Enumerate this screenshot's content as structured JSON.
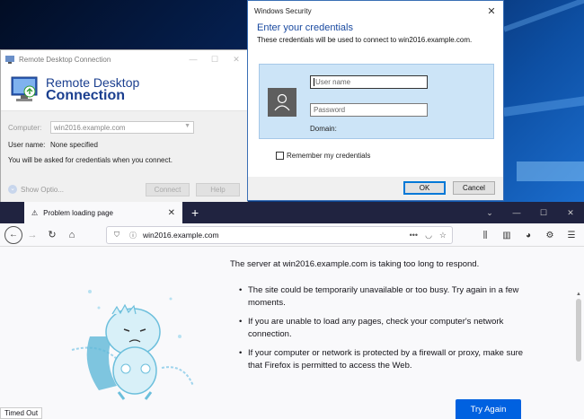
{
  "rdc": {
    "title": "Remote Desktop Connection",
    "heading_line1": "Remote Desktop",
    "heading_line2": "Connection",
    "computer_label": "Computer:",
    "computer_value": "win2016.example.com",
    "username_label": "User name:",
    "username_value": "None specified",
    "note": "You will be asked for credentials when you connect.",
    "show_options": "Show Optio...",
    "connect_label": "Connect",
    "help_label": "Help"
  },
  "security": {
    "title": "Windows Security",
    "heading": "Enter your credentials",
    "subtitle": "These credentials will be used to connect to win2016.example.com.",
    "username_placeholder": "User name",
    "password_placeholder": "Password",
    "domain_label": "Domain:",
    "remember_label": "Remember my credentials",
    "ok_label": "OK",
    "cancel_label": "Cancel"
  },
  "firefox": {
    "tab_title": "Problem loading page",
    "url": "win2016.example.com",
    "error_title": "The server at win2016.example.com is taking too long to respond.",
    "bullets": [
      "The site could be temporarily unavailable or too busy. Try again in a few moments.",
      "If you are unable to load any pages, check your computer's network connection.",
      "If your computer or network is protected by a firewall or proxy, make sure that Firefox is permitted to access the Web."
    ],
    "try_again_label": "Try Again",
    "status_text": "Timed Out"
  },
  "icons": {
    "tab_warning": "warning-icon",
    "close": "close-icon",
    "back": "back-arrow-icon",
    "forward": "forward-arrow-icon",
    "reload": "reload-icon",
    "home": "home-icon",
    "shield": "shield-icon",
    "info": "info-icon",
    "more": "more-dots-icon",
    "pocket": "pocket-icon",
    "bookmark": "star-icon",
    "library": "library-icon",
    "sidebar": "sidebar-icon",
    "account": "account-icon",
    "menu": "hamburger-menu-icon"
  },
  "colors": {
    "firefox_tabbar": "#202340",
    "try_again": "#0061e0",
    "credential_panel": "#cce4f7",
    "rdc_heading": "#1b3f8f"
  }
}
